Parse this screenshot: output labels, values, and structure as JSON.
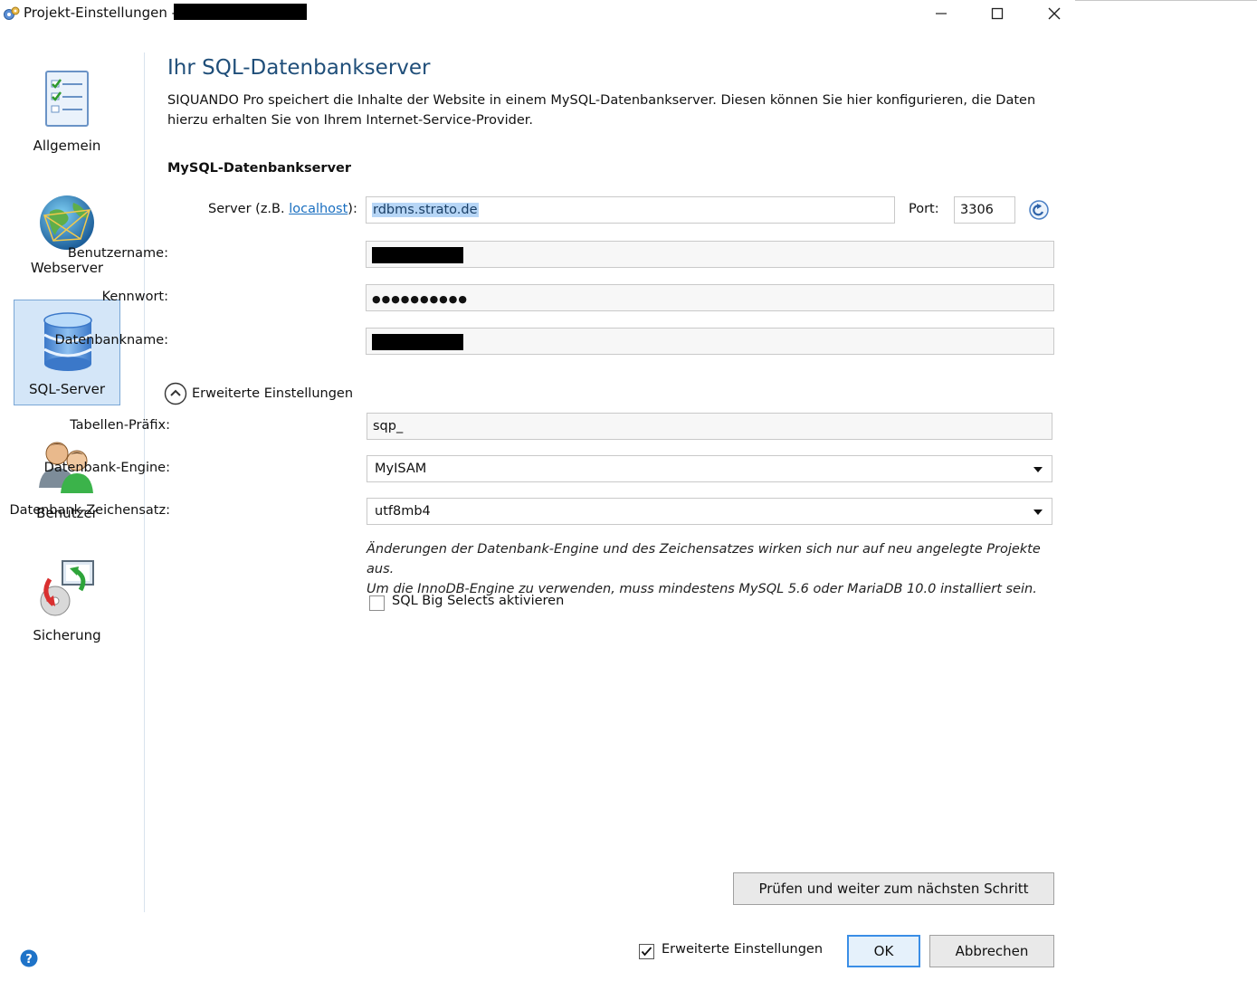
{
  "window": {
    "title": "Projekt-Einstellungen -",
    "controls": {
      "minimize": "—",
      "maximize": "☐",
      "close": "✕"
    }
  },
  "sidebar": {
    "items": [
      {
        "label": "Allgemein",
        "icon": "checklist-icon",
        "active": false
      },
      {
        "label": "Webserver",
        "icon": "globe-icon",
        "active": false
      },
      {
        "label": "SQL-Server",
        "icon": "database-icon",
        "active": true
      },
      {
        "label": "Benutzer",
        "icon": "users-icon",
        "active": false
      },
      {
        "label": "Sicherung",
        "icon": "backup-icon",
        "active": false
      }
    ]
  },
  "main": {
    "title": "Ihr SQL-Datenbankserver",
    "description": "SIQUANDO Pro speichert die Inhalte der Website in einem MySQL-Datenbankserver. Diesen können Sie hier konfigurieren, die Daten hierzu erhalten Sie von Ihrem Internet-Service-Provider.",
    "section_heading": "MySQL-Datenbankserver",
    "server": {
      "label_prefix": "Server (z.B. ",
      "label_link": "localhost",
      "label_suffix": "):",
      "value": "rdbms.strato.de"
    },
    "port": {
      "label": "Port:",
      "value": "3306"
    },
    "username": {
      "label": "Benutzername:"
    },
    "password": {
      "label": "Kennwort:",
      "value": "●●●●●●●●●●"
    },
    "dbname": {
      "label": "Datenbankname:"
    },
    "advanced_toggle": "Erweiterte Einstellungen",
    "table_prefix": {
      "label": "Tabellen-Präfix:",
      "value": "sqp_"
    },
    "engine": {
      "label": "Datenbank-Engine:",
      "value": "MyISAM"
    },
    "charset": {
      "label": "Datenbank-Zeichensatz:",
      "value": "utf8mb4"
    },
    "note_line1": "Änderungen der Datenbank-Engine und des Zeichensatzes wirken sich nur auf neu angelegte Projekte aus.",
    "note_line2": "Um die InnoDB-Engine zu verwenden, muss mindestens MySQL 5.6 oder MariaDB 10.0 installiert sein.",
    "big_selects": {
      "label": "SQL Big Selects aktivieren",
      "checked": false
    },
    "check_button": "Prüfen und weiter zum nächsten Schritt"
  },
  "footer": {
    "advanced_checkbox": {
      "label": "Erweiterte Einstellungen",
      "checked": true
    },
    "ok": "OK",
    "cancel": "Abbrechen"
  },
  "colors": {
    "accent": "#3a8ee6",
    "title": "#1f4e79",
    "link": "#1a6fc0",
    "active_nav": "#d4e6f8"
  }
}
